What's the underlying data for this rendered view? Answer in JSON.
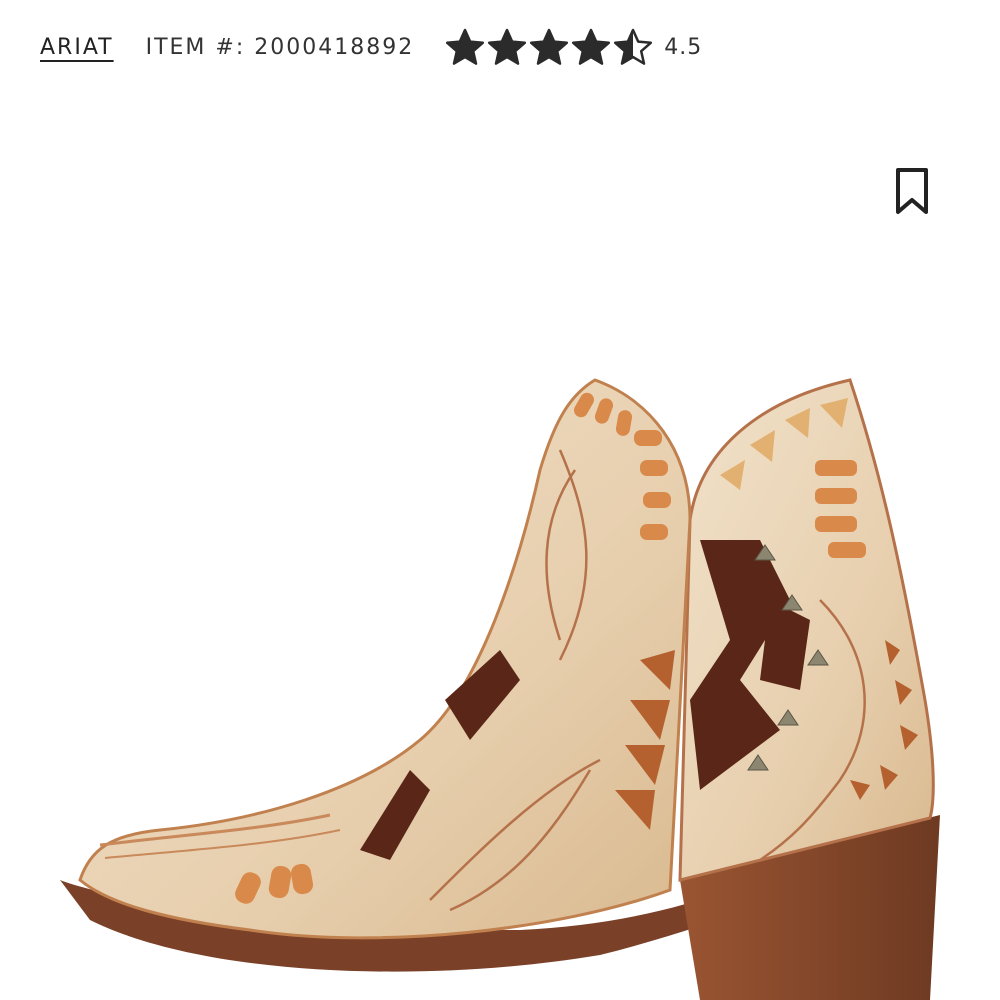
{
  "header": {
    "brand": "ARIAT",
    "item_number": "ITEM #: 2000418892",
    "rating_value": "4.5",
    "rating_stars": 4.5,
    "rating_max": 5
  },
  "icons": {
    "bookmark": "bookmark-icon",
    "star": "star-icon"
  },
  "colors": {
    "text": "#222222",
    "star": "#2b2b2b",
    "boot_leather": "#e7d2b4",
    "boot_inlay": "#5a2617",
    "boot_lacing": "#d98a4a",
    "heel": "#8a4a2a"
  }
}
